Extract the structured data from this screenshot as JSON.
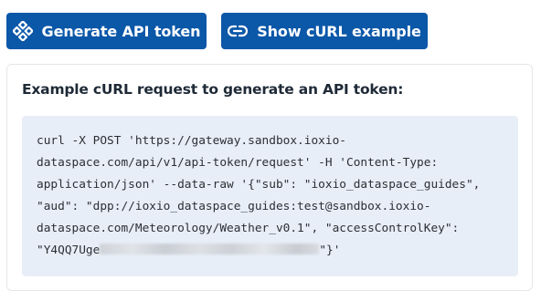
{
  "buttons": {
    "generate": {
      "label": "Generate API token",
      "icon": "diamond-grid-icon"
    },
    "curl": {
      "label": "Show cURL example",
      "icon": "link-icon"
    }
  },
  "panel": {
    "title": "Example cURL request to generate an API token:",
    "code_lines": [
      "curl -X POST 'https://gateway.sandbox.ioxio-",
      "dataspace.com/api/v1/api-token/request' -H 'Content-Type:",
      "application/json' --data-raw '{\"sub\": \"ioxio_dataspace_guides\",",
      "\"aud\": \"dpp://ioxio_dataspace_guides:test@sandbox.ioxio-",
      "dataspace.com/Meteorology/Weather_v0.1\", \"accessControlKey\":"
    ],
    "last_line_prefix": "\"Y4QQ7Uge",
    "last_line_suffix": "\"}'"
  },
  "colors": {
    "button_bg": "#0b57a8",
    "button_text": "#ffffff",
    "code_bg": "#e8eef7",
    "title_text": "#1f2a37"
  }
}
